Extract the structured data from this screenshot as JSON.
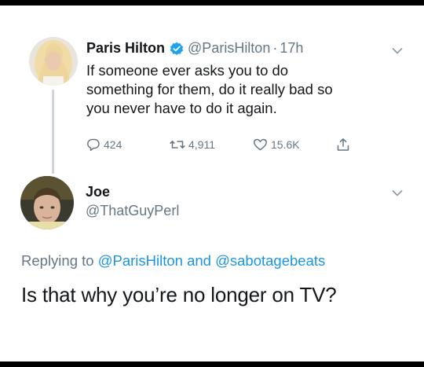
{
  "tweet": {
    "author_name": "Paris Hilton",
    "verified": true,
    "handle": "@ParisHilton",
    "separator": "·",
    "time": "17h",
    "text_lines": [
      "If someone ever asks you to do",
      "something for them, do it really bad so",
      "you never have to do it again."
    ],
    "reply_count": "424",
    "retweet_count": "4,911",
    "like_count": "15.6K",
    "icons": {
      "reply": "reply-icon",
      "retweet": "retweet-icon",
      "like": "heart-icon",
      "share": "share-icon",
      "menu": "chevron-down-icon",
      "verified": "verified-badge-icon"
    }
  },
  "reply": {
    "author_name": "Joe",
    "handle": "@ThatGuyPerl",
    "replying_prefix": "Replying to",
    "replying_to_1": "@ParisHilton",
    "replying_and": "and",
    "replying_to_2": "@sabotagebeats",
    "text": "Is that why you’re no longer on TV?"
  },
  "colors": {
    "text": "#14171a",
    "secondary": "#657786",
    "link": "#1b95e0",
    "verified": "#1da1f2",
    "thread_line": "#d0d6dc",
    "frame": "#000000"
  }
}
